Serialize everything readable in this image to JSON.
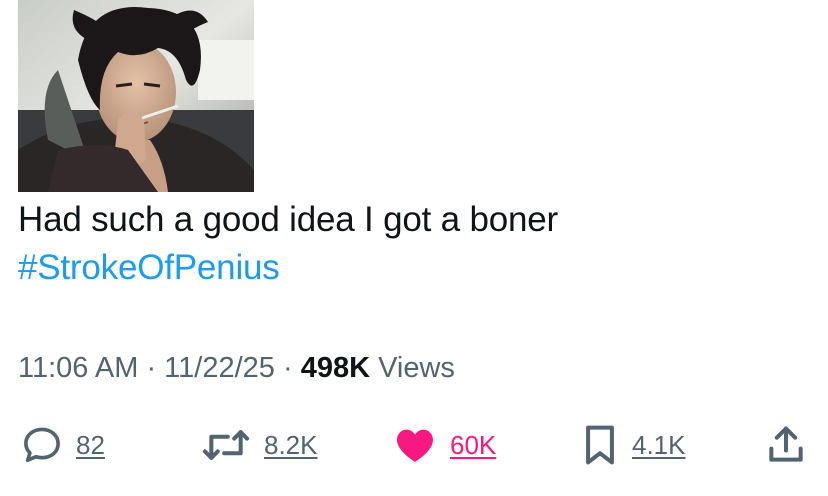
{
  "tweet": {
    "text_line1": "Had such a good idea I got a boner",
    "hashtag": "#StrokeOfPenius"
  },
  "meta": {
    "time": "11:06 AM",
    "separator": " · ",
    "date": "11/22/25",
    "views_count": "498K",
    "views_label": "Views"
  },
  "actions": {
    "replies": "82",
    "reposts": "8.2K",
    "likes": "60K",
    "bookmarks": "4.1K"
  },
  "colors": {
    "text": "#0f1419",
    "secondary": "#536471",
    "hashtag": "#1d9bf0",
    "like": "#f91880"
  },
  "icons": {
    "reply": "reply-bubble-icon",
    "repost": "repost-arrows-icon",
    "like": "heart-filled-icon",
    "bookmark": "bookmark-icon",
    "share": "share-upload-icon"
  }
}
